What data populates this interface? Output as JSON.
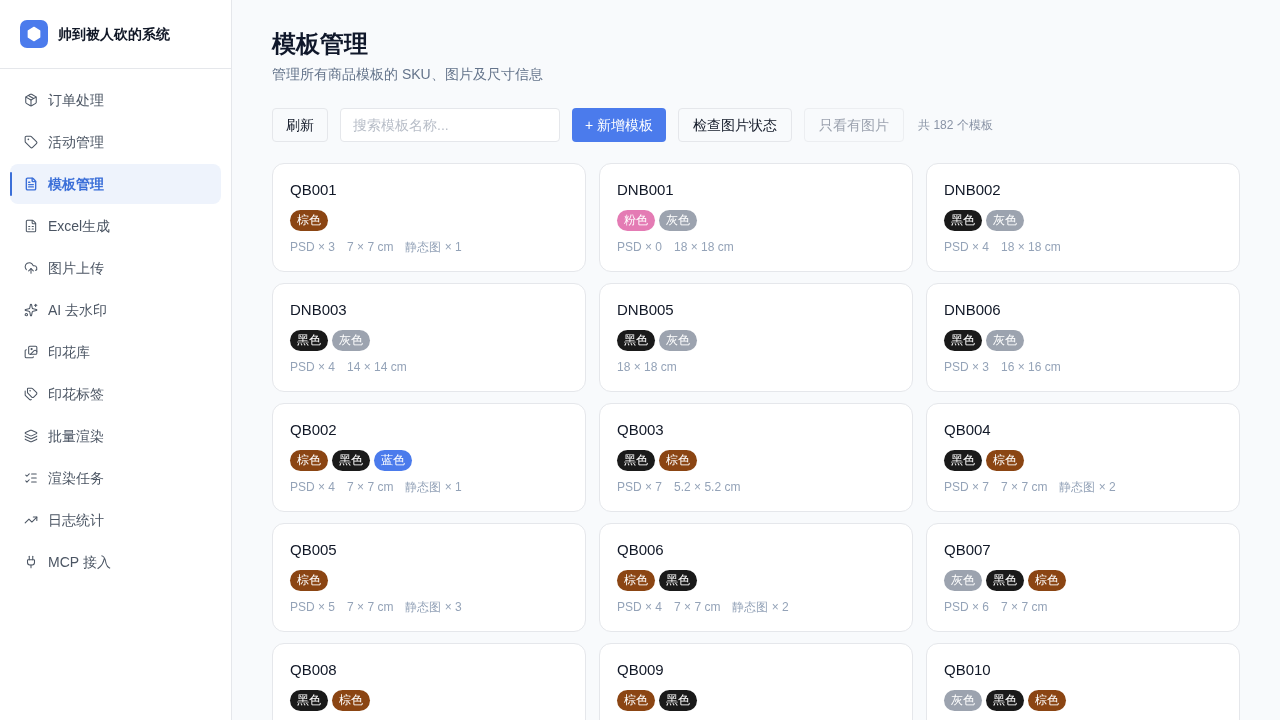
{
  "sidebar": {
    "brand": "帅到被人砍的系统",
    "items": [
      {
        "label": "订单处理",
        "selected": false
      },
      {
        "label": "活动管理",
        "selected": false
      },
      {
        "label": "模板管理",
        "selected": true
      },
      {
        "label": "Excel生成",
        "selected": false
      },
      {
        "label": "图片上传",
        "selected": false
      },
      {
        "label": "AI 去水印",
        "selected": false
      },
      {
        "label": "印花库",
        "selected": false
      },
      {
        "label": "印花标签",
        "selected": false
      },
      {
        "label": "批量渲染",
        "selected": false
      },
      {
        "label": "渲染任务",
        "selected": false
      },
      {
        "label": "日志统计",
        "selected": false
      },
      {
        "label": "MCP 接入",
        "selected": false
      }
    ]
  },
  "header": {
    "title": "模板管理",
    "subtitle": "管理所有商品模板的 SKU、图片及尺寸信息"
  },
  "toolbar": {
    "refresh_button": "刷新",
    "search": {
      "placeholder": "搜索模板名称..."
    },
    "add_button": "+ 新增模板",
    "check_button": "检查图片状态",
    "image_filter": {
      "label": "只看有图片",
      "on": false
    },
    "count": "共 182 个模板"
  },
  "templates": [
    {
      "name": "QB001",
      "tags": [
        {
          "label": "棕色",
          "color": "#8b4513"
        }
      ],
      "meta": [
        "PSD × 3",
        "7 × 7 cm",
        "静态图 × 1"
      ]
    },
    {
      "name": "DNB001",
      "tags": [
        {
          "label": "粉色",
          "color": "#e47bb4"
        },
        {
          "label": "灰色",
          "color": "#9ca3af"
        }
      ],
      "meta": [
        "PSD × 0",
        "18 × 18 cm"
      ]
    },
    {
      "name": "DNB002",
      "tags": [
        {
          "label": "黑色",
          "color": "#1a1a1a"
        },
        {
          "label": "灰色",
          "color": "#9ca3af"
        }
      ],
      "meta": [
        "PSD × 4",
        "18 × 18 cm"
      ]
    },
    {
      "name": "DNB003",
      "tags": [
        {
          "label": "黑色",
          "color": "#1a1a1a"
        },
        {
          "label": "灰色",
          "color": "#9ca3af"
        }
      ],
      "meta": [
        "PSD × 4",
        "14 × 14 cm"
      ]
    },
    {
      "name": "DNB005",
      "tags": [
        {
          "label": "黑色",
          "color": "#1a1a1a"
        },
        {
          "label": "灰色",
          "color": "#9ca3af"
        }
      ],
      "meta": [
        "18 × 18 cm"
      ]
    },
    {
      "name": "DNB006",
      "tags": [
        {
          "label": "黑色",
          "color": "#1a1a1a"
        },
        {
          "label": "灰色",
          "color": "#9ca3af"
        }
      ],
      "meta": [
        "PSD × 3",
        "16 × 16 cm"
      ]
    },
    {
      "name": "QB002",
      "tags": [
        {
          "label": "棕色",
          "color": "#8b4513"
        },
        {
          "label": "黑色",
          "color": "#1a1a1a"
        },
        {
          "label": "蓝色",
          "color": "#4b7bec"
        }
      ],
      "meta": [
        "PSD × 4",
        "7 × 7 cm",
        "静态图 × 1"
      ]
    },
    {
      "name": "QB003",
      "tags": [
        {
          "label": "黑色",
          "color": "#1a1a1a"
        },
        {
          "label": "棕色",
          "color": "#8b4513"
        }
      ],
      "meta": [
        "PSD × 7",
        "5.2 × 5.2 cm"
      ]
    },
    {
      "name": "QB004",
      "tags": [
        {
          "label": "黑色",
          "color": "#1a1a1a"
        },
        {
          "label": "棕色",
          "color": "#8b4513"
        }
      ],
      "meta": [
        "PSD × 7",
        "7 × 7 cm",
        "静态图 × 2"
      ]
    },
    {
      "name": "QB005",
      "tags": [
        {
          "label": "棕色",
          "color": "#8b4513"
        }
      ],
      "meta": [
        "PSD × 5",
        "7 × 7 cm",
        "静态图 × 3"
      ]
    },
    {
      "name": "QB006",
      "tags": [
        {
          "label": "棕色",
          "color": "#8b4513"
        },
        {
          "label": "黑色",
          "color": "#1a1a1a"
        }
      ],
      "meta": [
        "PSD × 4",
        "7 × 7 cm",
        "静态图 × 2"
      ]
    },
    {
      "name": "QB007",
      "tags": [
        {
          "label": "灰色",
          "color": "#9ca3af"
        },
        {
          "label": "黑色",
          "color": "#1a1a1a"
        },
        {
          "label": "棕色",
          "color": "#8b4513"
        }
      ],
      "meta": [
        "PSD × 6",
        "7 × 7 cm"
      ]
    },
    {
      "name": "QB008",
      "tags": [
        {
          "label": "黑色",
          "color": "#1a1a1a"
        },
        {
          "label": "棕色",
          "color": "#8b4513"
        }
      ]
    },
    {
      "name": "QB009",
      "tags": [
        {
          "label": "棕色",
          "color": "#8b4513"
        },
        {
          "label": "黑色",
          "color": "#1a1a1a"
        }
      ]
    },
    {
      "name": "QB010",
      "tags": [
        {
          "label": "灰色",
          "color": "#9ca3af"
        },
        {
          "label": "黑色",
          "color": "#1a1a1a"
        },
        {
          "label": "棕色",
          "color": "#8b4513"
        }
      ]
    }
  ]
}
